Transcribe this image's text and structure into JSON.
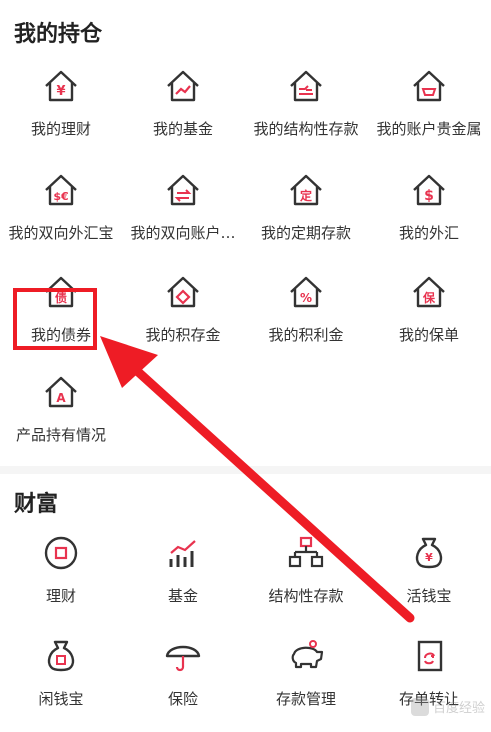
{
  "holdings": {
    "title": "我的持仓",
    "items": [
      {
        "label": "我的理财",
        "icon": "wealth-yen-icon",
        "glyph": "¥"
      },
      {
        "label": "我的基金",
        "icon": "fund-trend-icon",
        "glyph": "～"
      },
      {
        "label": "我的结构性存款",
        "icon": "structured-deposit-icon",
        "glyph": "⇄"
      },
      {
        "label": "我的账户贵金属",
        "icon": "precious-metal-icon",
        "glyph": "◡"
      },
      {
        "label": "我的双向外汇宝",
        "icon": "two-way-fx-icon",
        "glyph": "$€"
      },
      {
        "label": "我的双向账户…",
        "icon": "two-way-account-icon",
        "glyph": "⇌"
      },
      {
        "label": "我的定期存款",
        "icon": "fixed-deposit-icon",
        "glyph": "定"
      },
      {
        "label": "我的外汇",
        "icon": "forex-icon",
        "glyph": "$"
      },
      {
        "label": "我的债券",
        "icon": "bond-icon",
        "glyph": "债"
      },
      {
        "label": "我的积存金",
        "icon": "gold-accumulation-icon",
        "glyph": "◇"
      },
      {
        "label": "我的积利金",
        "icon": "interest-gold-icon",
        "glyph": "%"
      },
      {
        "label": "我的保单",
        "icon": "insurance-policy-icon",
        "glyph": "保"
      },
      {
        "label": "产品持有情况",
        "icon": "product-holdings-icon",
        "glyph": "A"
      }
    ]
  },
  "wealth": {
    "title": "财富",
    "items": [
      {
        "label": "理财",
        "icon": "wealth-management-icon"
      },
      {
        "label": "基金",
        "icon": "fund-chart-icon"
      },
      {
        "label": "结构性存款",
        "icon": "structured-deposit-tree-icon"
      },
      {
        "label": "活钱宝",
        "icon": "money-bag-yen-icon",
        "glyph": "¥"
      },
      {
        "label": "闲钱宝",
        "icon": "money-bag-icon"
      },
      {
        "label": "保险",
        "icon": "umbrella-icon"
      },
      {
        "label": "存款管理",
        "icon": "piggy-bank-icon"
      },
      {
        "label": "存单转让",
        "icon": "deposit-transfer-icon"
      }
    ]
  },
  "watermark": {
    "text": "百度经验"
  },
  "colors": {
    "accent": "#e8334f",
    "icon_stroke": "#333333",
    "annotation": "#ee1c25"
  }
}
